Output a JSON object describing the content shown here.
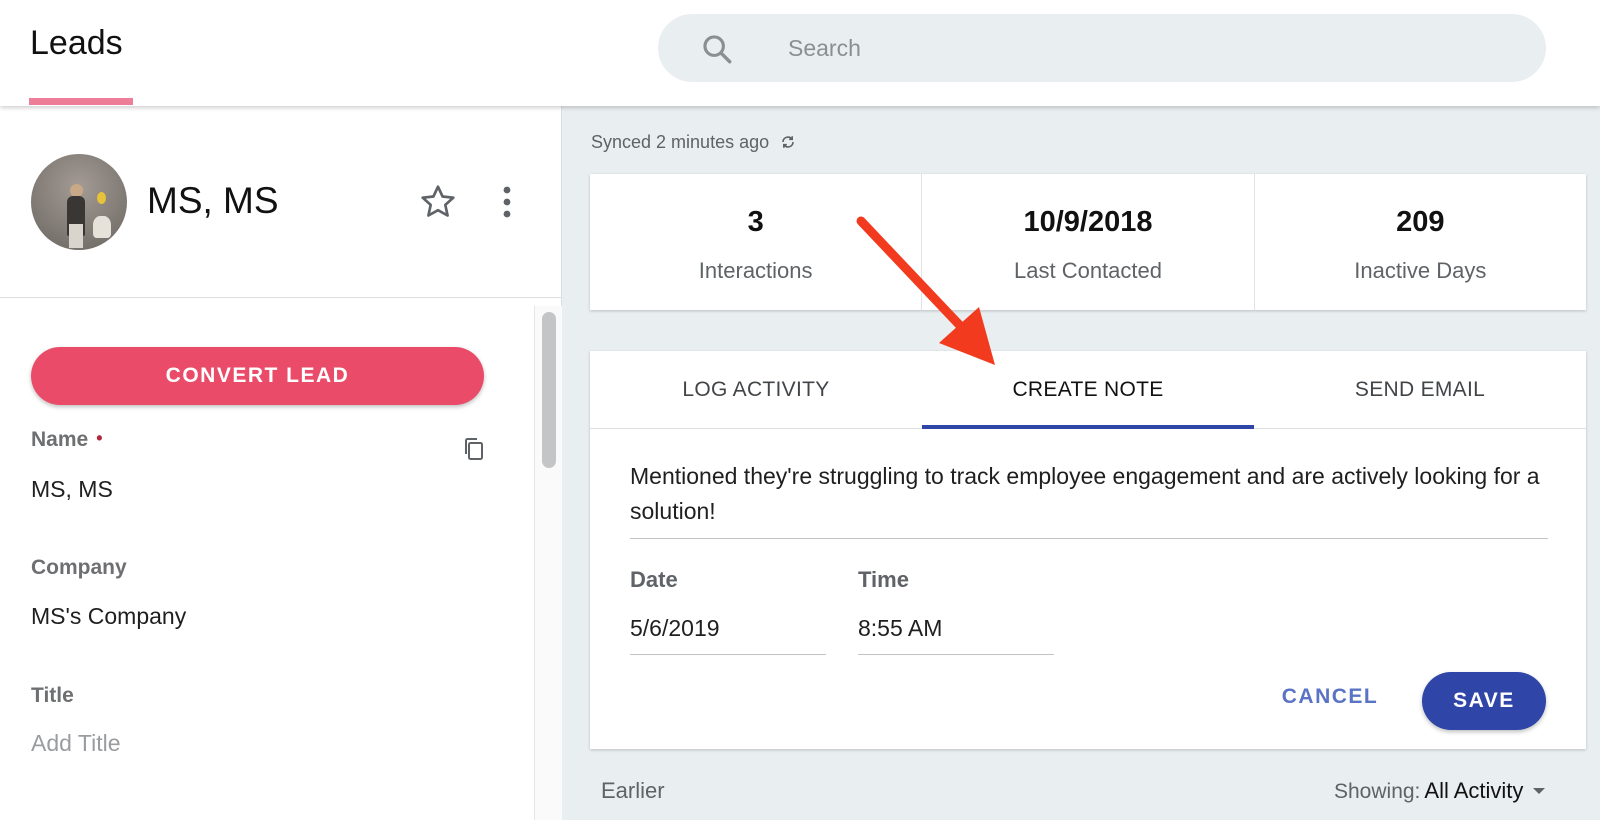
{
  "header": {
    "title": "Leads",
    "search": {
      "placeholder": "Search",
      "icon": "search-icon"
    }
  },
  "profile": {
    "name": "MS, MS",
    "icons": [
      "avatar",
      "star-icon",
      "more-vert-icon"
    ]
  },
  "sidebar": {
    "convert_label": "CONVERT LEAD",
    "fields": {
      "name": {
        "label": "Name",
        "required_marker": "•",
        "value": "MS, MS"
      },
      "company": {
        "label": "Company",
        "value": "MS's Company"
      },
      "title": {
        "label": "Title",
        "placeholder": "Add Title"
      }
    }
  },
  "main": {
    "synced_text": "Synced 2 minutes ago",
    "stats": [
      {
        "value": "3",
        "label": "Interactions"
      },
      {
        "value": "10/9/2018",
        "label": "Last Contacted"
      },
      {
        "value": "209",
        "label": "Inactive Days"
      }
    ],
    "tabs": [
      {
        "label": "LOG ACTIVITY",
        "active": false
      },
      {
        "label": "CREATE NOTE",
        "active": true
      },
      {
        "label": "SEND EMAIL",
        "active": false
      }
    ],
    "note": {
      "text": "Mentioned they're struggling to track employee engagement and are actively looking for a solution!",
      "date_label": "Date",
      "date_value": "5/6/2019",
      "time_label": "Time",
      "time_value": "8:55 AM",
      "cancel_label": "CANCEL",
      "save_label": "SAVE"
    },
    "earlier_label": "Earlier",
    "showing_label": "Showing:",
    "showing_value": "All Activity"
  },
  "colors": {
    "accent_pink": "#e94b69",
    "tab_underline": "#ee7e97",
    "primary_blue": "#2f45a7",
    "annotation_arrow": "#f23a1f"
  }
}
